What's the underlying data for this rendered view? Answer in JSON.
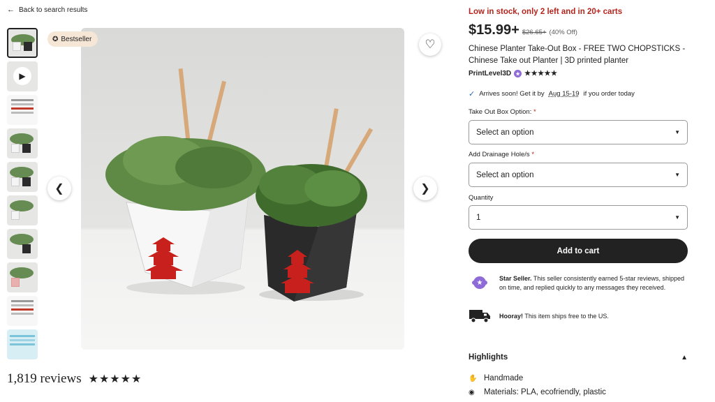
{
  "nav": {
    "back_label": "Back to search results"
  },
  "gallery": {
    "badge": "Bestseller",
    "thumbnail_count": 10
  },
  "reviews": {
    "count_label": "1,819 reviews",
    "stars": "★★★★★"
  },
  "product": {
    "stock_notice": "Low in stock, only 2 left and in 20+ carts",
    "price": "$15.99+",
    "original_price": "$26.65+",
    "discount": "(40% Off)",
    "title": "Chinese Planter Take-Out Box - FREE TWO CHOPSTICKS - Chinese Take out Planter | 3D printed planter",
    "seller": "PrintLevel3D",
    "seller_stars": "★★★★★",
    "arrival_prefix": "Arrives soon! Get it by",
    "arrival_date": "Aug 15-19",
    "arrival_suffix": "if you order today"
  },
  "options": {
    "box_label": "Take Out Box Option:",
    "box_value": "Select an option",
    "drainage_label": "Add Drainage Hole/s",
    "drainage_value": "Select an option",
    "quantity_label": "Quantity",
    "quantity_value": "1",
    "required_mark": "*"
  },
  "cart": {
    "button_label": "Add to cart"
  },
  "perks": {
    "star_seller_title": "Star Seller.",
    "star_seller_text": "This seller consistently earned 5-star reviews, shipped on time, and replied quickly to any messages they received.",
    "shipping_title": "Hooray!",
    "shipping_text": "This item ships free to the US."
  },
  "highlights": {
    "title": "Highlights",
    "items": [
      {
        "label": "Handmade"
      },
      {
        "label": "Materials: PLA, ecofriendly, plastic"
      }
    ]
  },
  "colors": {
    "stock_red": "#b3261e",
    "button_dark": "#222222",
    "star_seller_purple": "#8e6bd6",
    "badge_bg": "#f5e6d5"
  }
}
